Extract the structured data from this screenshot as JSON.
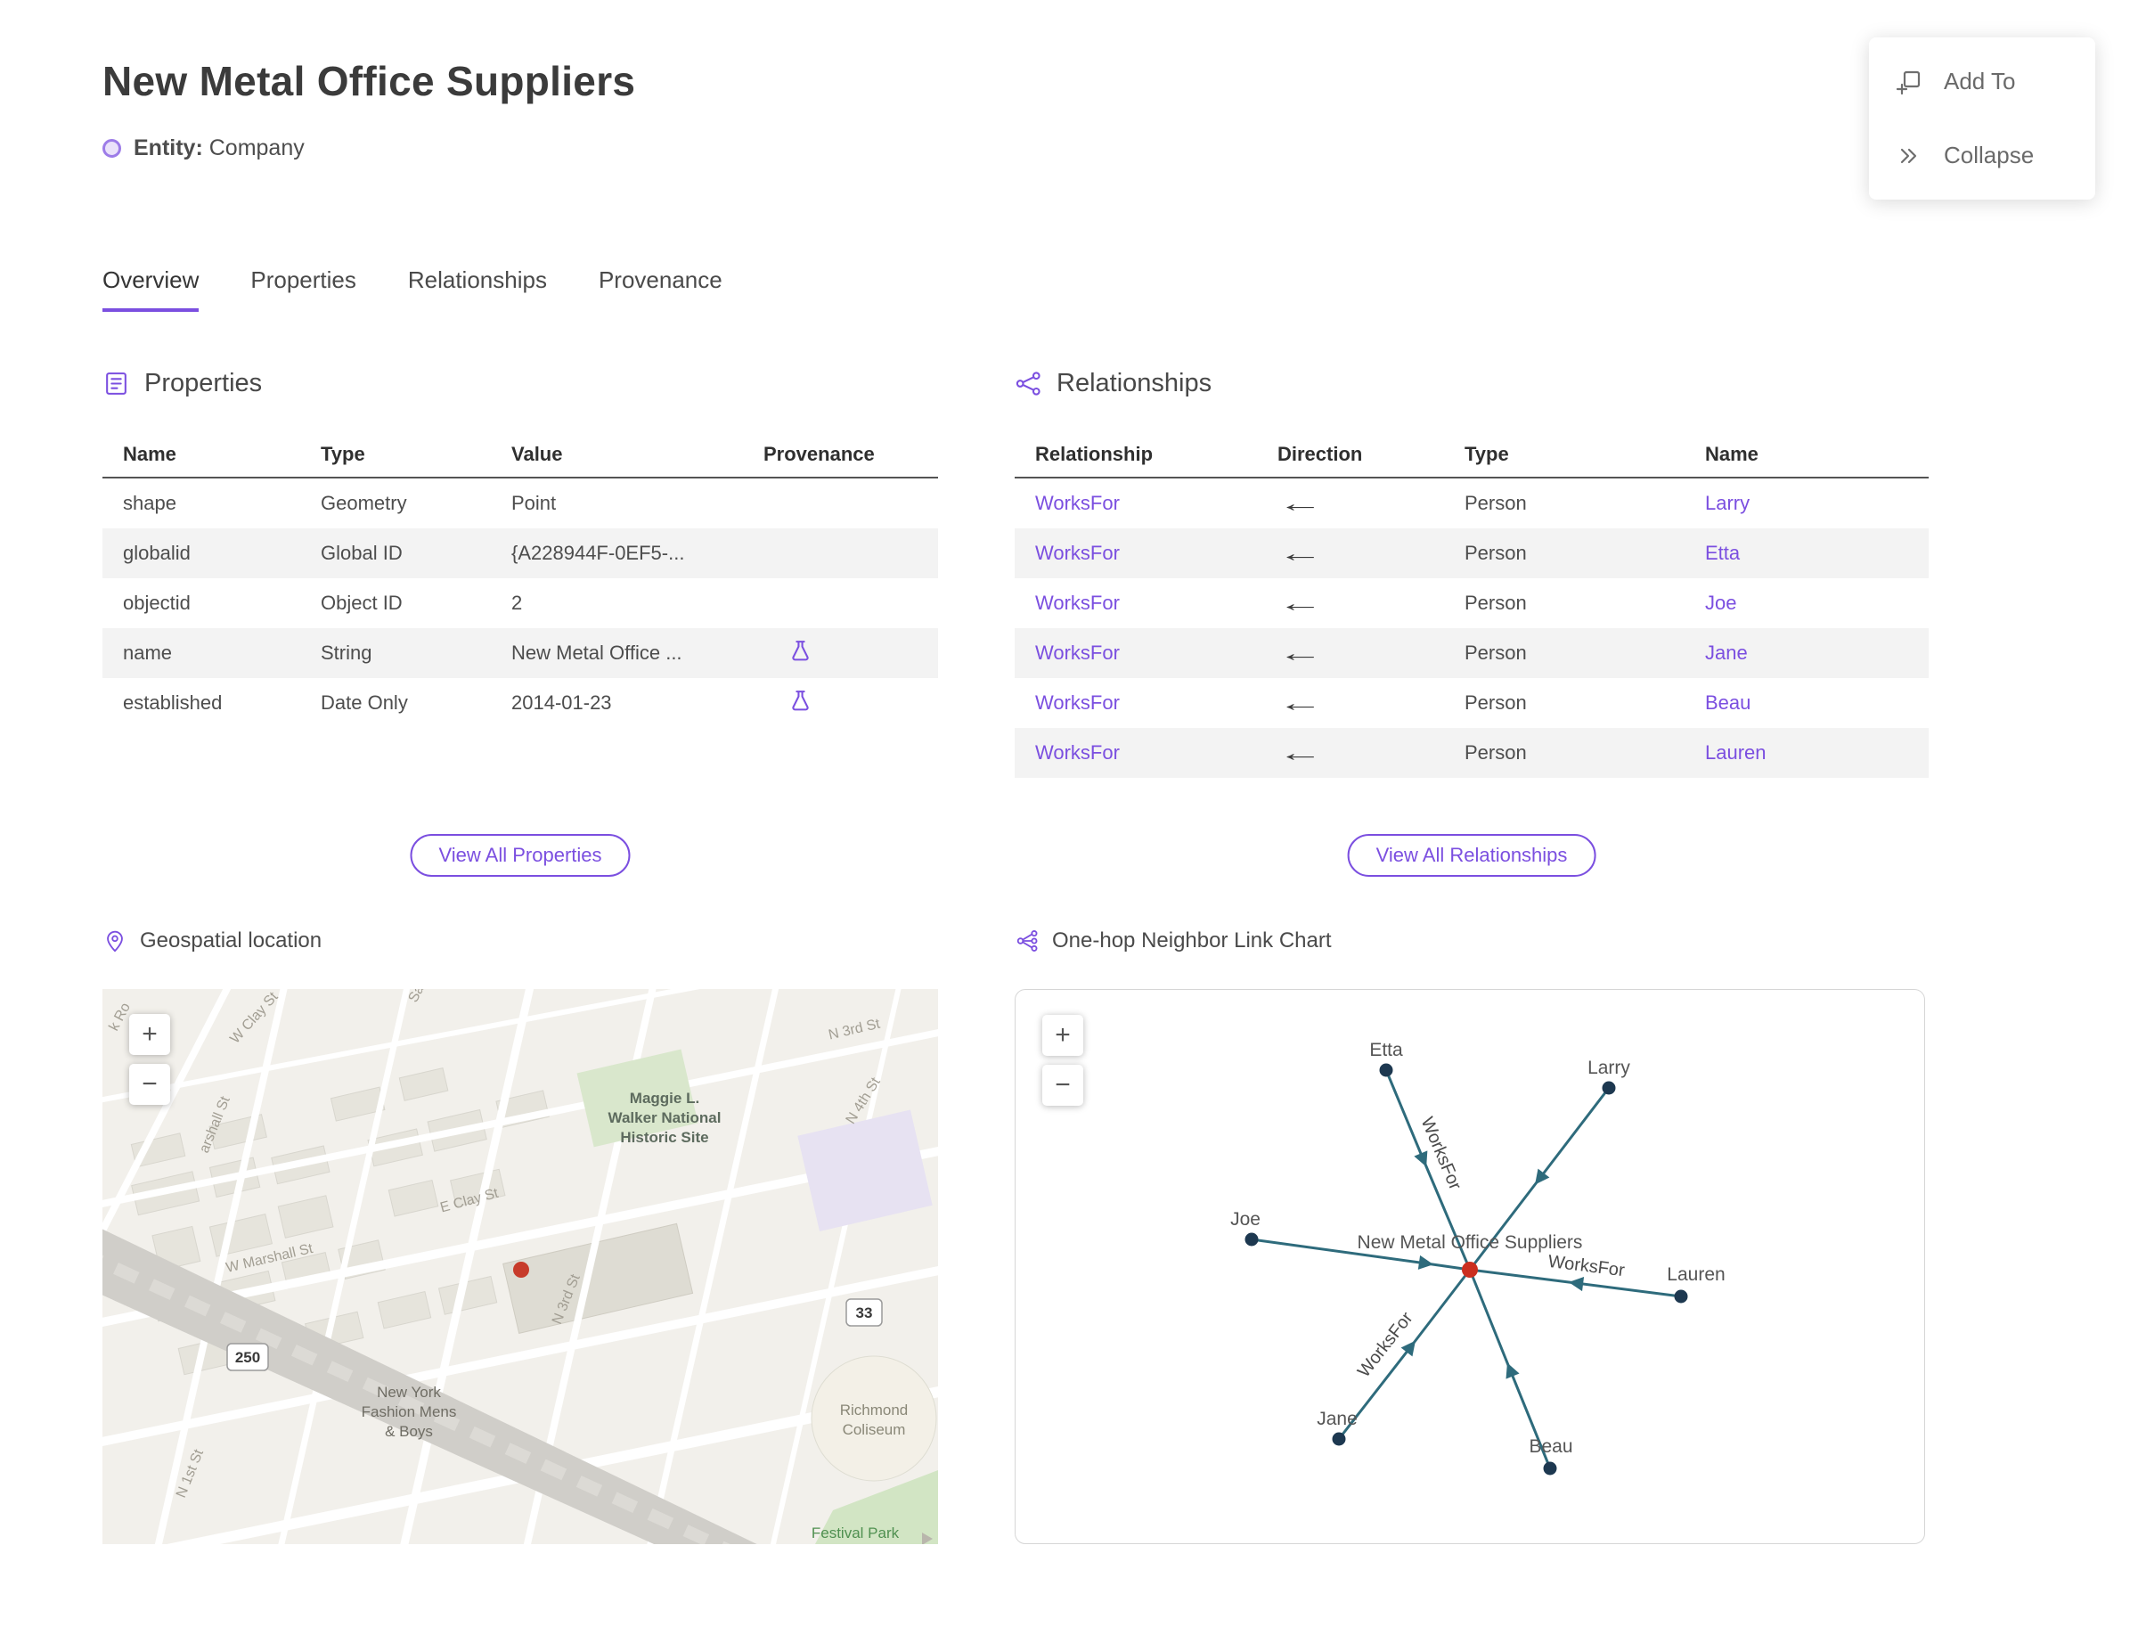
{
  "header": {
    "title": "New Metal Office Suppliers",
    "entity_label": "Entity:",
    "entity_type": "Company"
  },
  "actions": {
    "add_to": "Add To",
    "collapse": "Collapse"
  },
  "tabs": [
    {
      "label": "Overview"
    },
    {
      "label": "Properties"
    },
    {
      "label": "Relationships"
    },
    {
      "label": "Provenance"
    }
  ],
  "properties": {
    "title": "Properties",
    "columns": {
      "name": "Name",
      "type": "Type",
      "value": "Value",
      "provenance": "Provenance"
    },
    "rows": [
      {
        "name": "shape",
        "type": "Geometry",
        "value": "Point"
      },
      {
        "name": "globalid",
        "type": "Global ID",
        "value": "{A228944F-0EF5-..."
      },
      {
        "name": "objectid",
        "type": "Object ID",
        "value": "2"
      },
      {
        "name": "name",
        "type": "String",
        "value": "New Metal Office ..."
      },
      {
        "name": "established",
        "type": "Date Only",
        "value": "2014-01-23"
      }
    ],
    "view_all": "View All Properties"
  },
  "relationships": {
    "title": "Relationships",
    "columns": {
      "relationship": "Relationship",
      "direction": "Direction",
      "type": "Type",
      "name": "Name"
    },
    "rows": [
      {
        "relationship": "WorksFor",
        "direction": "←",
        "type": "Person",
        "name": "Larry"
      },
      {
        "relationship": "WorksFor",
        "direction": "←",
        "type": "Person",
        "name": "Etta"
      },
      {
        "relationship": "WorksFor",
        "direction": "←",
        "type": "Person",
        "name": "Joe"
      },
      {
        "relationship": "WorksFor",
        "direction": "←",
        "type": "Person",
        "name": "Jane"
      },
      {
        "relationship": "WorksFor",
        "direction": "←",
        "type": "Person",
        "name": "Beau"
      },
      {
        "relationship": "WorksFor",
        "direction": "←",
        "type": "Person",
        "name": "Lauren"
      }
    ],
    "view_all": "View All Relationships"
  },
  "map": {
    "title": "Geospatial location",
    "zoom_in": "+",
    "zoom_out": "−",
    "labels": {
      "brook_rd": "k Ro",
      "w_clay_st": "W Clay St",
      "sa": "Sa",
      "n_3rd_st_top": "N 3rd St",
      "n_4th_st": "N 4th St",
      "historic_site_1": "Maggie L.",
      "historic_site_2": "Walker National",
      "historic_site_3": "Historic Site",
      "marshall_st": "arshall St",
      "w_marshall_st": "W Marshall St",
      "e_clay_st": "E Clay St",
      "n_3rd_st_mid": "N 3rd St",
      "route_250": "250",
      "route_33": "33",
      "ny_fashion_1": "New York",
      "ny_fashion_2": "Fashion Mens",
      "ny_fashion_3": "& Boys",
      "coliseum_1": "Richmond",
      "coliseum_2": "Coliseum",
      "festival_park": "Festival Park",
      "n_1st_st": "N 1st St"
    }
  },
  "chart": {
    "title": "One-hop Neighbor Link Chart",
    "zoom_in": "+",
    "zoom_out": "−",
    "center_label": "New Metal Office Suppliers",
    "edge_label": "WorksFor",
    "nodes": [
      {
        "label": "Etta"
      },
      {
        "label": "Larry"
      },
      {
        "label": "Joe"
      },
      {
        "label": "Lauren"
      },
      {
        "label": "Jane"
      },
      {
        "label": "Beau"
      }
    ]
  },
  "colors": {
    "accent": "#7b4fe0",
    "edge": "#2e6b7c",
    "node": "#1d3850",
    "center_node": "#cb2f20",
    "map_marker": "#c73b2a"
  }
}
